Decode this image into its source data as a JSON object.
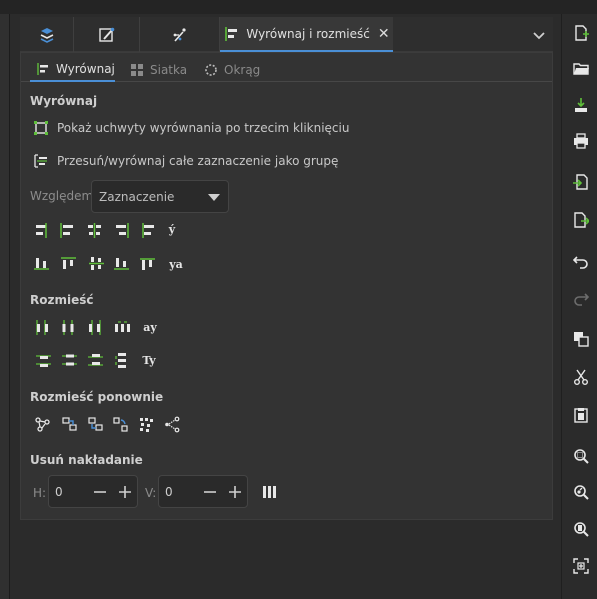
{
  "dock": {
    "active_tab_label": "Wyrównaj i rozmieść",
    "close_glyph": "✕",
    "tabs": [
      {
        "icon": "layers-icon"
      },
      {
        "icon": "fill-stroke-icon"
      },
      {
        "icon": "xml-editor-icon"
      },
      {
        "icon": "align-distribute-icon",
        "label": "Wyrównaj i rozmieść"
      }
    ],
    "menu_icon": "chevron-down-icon"
  },
  "subtabs": [
    {
      "label": "Wyrównaj",
      "active": true,
      "icon": "align-icon"
    },
    {
      "label": "Siatka",
      "active": false,
      "icon": "grid-icon"
    },
    {
      "label": "Okrąg",
      "active": false,
      "icon": "circle-icon"
    }
  ],
  "align": {
    "section_title": "Wyrównaj",
    "option_handles": "Pokaż uchwyty wyrównania po trzecim kliknięciu",
    "option_group": "Przesuń/wyrównaj całe zaznaczenie jako grupę",
    "relative_label": "Względem:",
    "relative_value": "Zaznaczenie",
    "row1_text_glyph": "ý",
    "row2_text_glyph": "ya"
  },
  "distribute": {
    "section_title": "Rozmieść",
    "row1_text_glyph": "ay",
    "row2_text_glyph": "Ty"
  },
  "rearrange": {
    "section_title": "Rozmieść ponownie"
  },
  "overlap": {
    "section_title": "Usuń nakładanie",
    "h_label": "H:",
    "h_value": "0",
    "v_label": "V:",
    "v_value": "0"
  },
  "colors": {
    "accent": "#4a8fd6",
    "guide": "#5fbf3a",
    "icon": "#e8e8e8",
    "panel_bg": "#333333"
  }
}
